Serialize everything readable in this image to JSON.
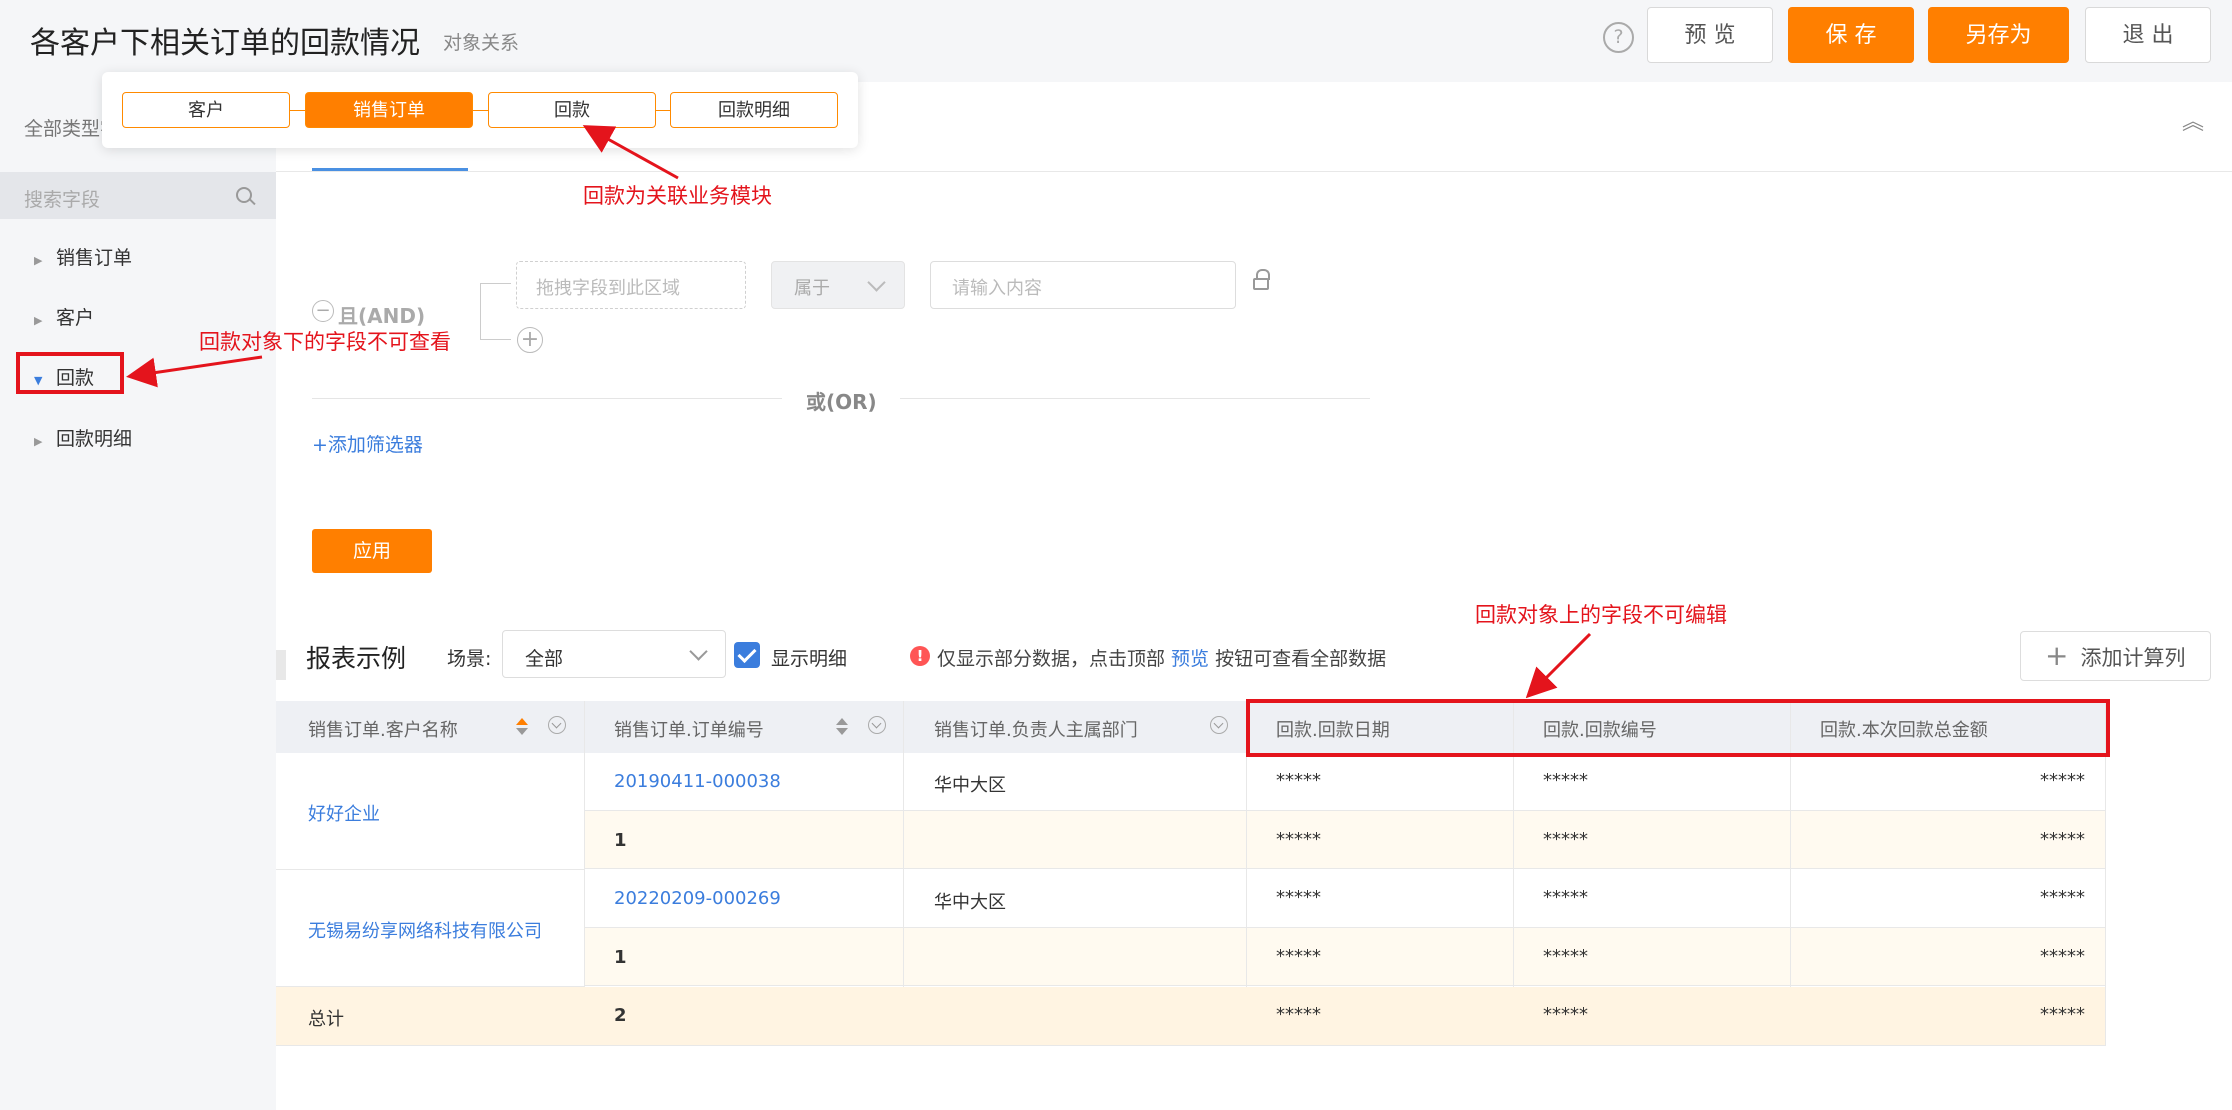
{
  "header": {
    "title": "各客户下相关订单的回款情况",
    "subtitle": "对象关系",
    "help": "?",
    "buttons": {
      "preview": "预 览",
      "save": "保 存",
      "save_as": "另存为",
      "exit": "退 出"
    }
  },
  "relation_popup": {
    "chips": [
      "客户",
      "销售订单",
      "回款",
      "回款明细"
    ],
    "active": "销售订单"
  },
  "sidebar": {
    "type_label": "全部类型字",
    "search_placeholder": "搜索字段",
    "items": [
      {
        "label": "销售订单",
        "expanded": false
      },
      {
        "label": "客户",
        "expanded": false
      },
      {
        "label": "回款",
        "expanded": true
      },
      {
        "label": "回款明细",
        "expanded": false
      }
    ]
  },
  "filter": {
    "and_label": "且(AND)",
    "drop_placeholder": "拖拽字段到此区域",
    "operator": "属于",
    "value_placeholder": "请输入内容",
    "or_label": "或(OR)",
    "add_filter": "+添加筛选器",
    "apply": "应用"
  },
  "report": {
    "title": "报表示例",
    "scene_label": "场景:",
    "scene_value": "全部",
    "show_detail_label": "显示明细",
    "show_detail_checked": true,
    "notice_before": "仅显示部分数据，点击顶部 ",
    "notice_link": "预览",
    "notice_after": " 按钮可查看全部数据",
    "add_calc": "添加计算列"
  },
  "table": {
    "columns": [
      "销售订单.客户名称",
      "销售订单.订单编号",
      "销售订单.负责人主属部门",
      "回款.回款日期",
      "回款.回款编号",
      "回款.本次回款总金额"
    ],
    "groups": [
      {
        "customer": "好好企业",
        "order_no": "20190411-000038",
        "department": "华中大区",
        "count": "1"
      },
      {
        "customer": "无锡易纷享网络科技有限公司",
        "order_no": "20220209-000269",
        "department": "华中大区",
        "count": "1"
      }
    ],
    "mask": "*****",
    "total_label": "总计",
    "total_count": "2"
  },
  "annotations": {
    "relation": "回款为关联业务模块",
    "sidebar": "回款对象下的字段不可查看",
    "columns": "回款对象上的字段不可编辑"
  },
  "colors": {
    "accent": "#ff7f00",
    "link": "#3b7ddd",
    "annotation": "#e4141c"
  }
}
